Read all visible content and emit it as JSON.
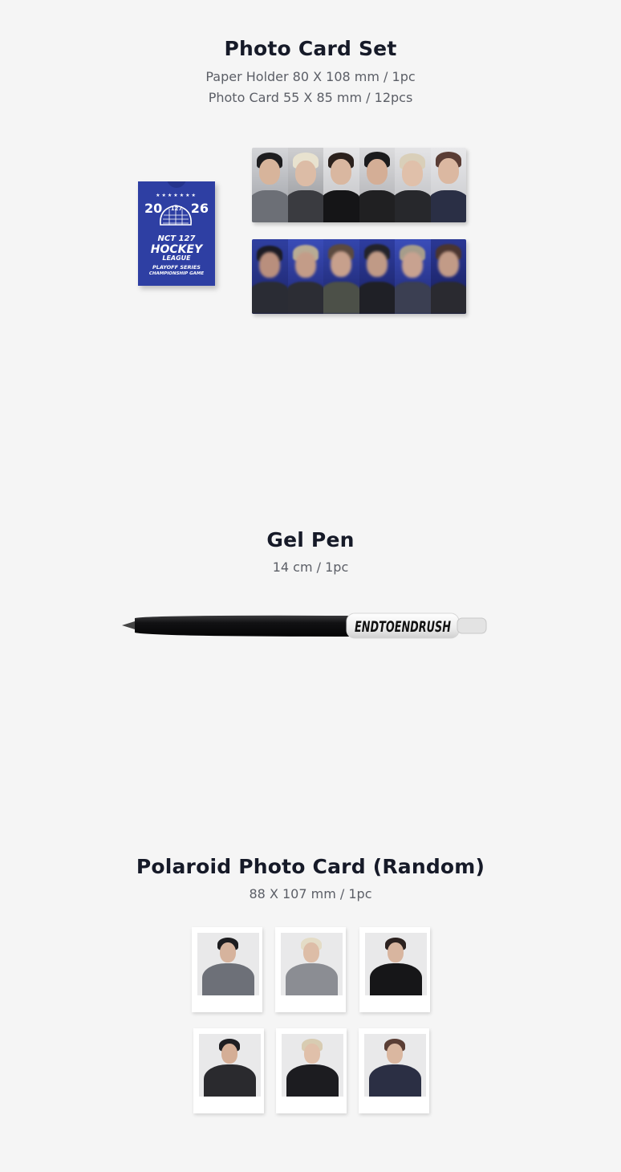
{
  "photo_card_set": {
    "title": "Photo Card Set",
    "spec_line_1": "Paper Holder 80 X 108 mm / 1pc",
    "spec_line_2": "Photo Card 55 X 85 mm / 12pcs",
    "holder": {
      "year_left": "20",
      "year_right": "26",
      "helmet_number": "127",
      "line_1": "NCT 127",
      "line_2": "HOCKEY",
      "line_3": "LEAGUE",
      "line_4": "PLAYOFF SERIES",
      "line_5": "CHAMPIONSHIP GAME",
      "color": "#2e3fa3"
    }
  },
  "gel_pen": {
    "title": "Gel Pen",
    "spec": "14 cm / 1pc",
    "clip_text": "ENDTOENDRUSH"
  },
  "polaroid": {
    "title": "Polaroid Photo Card (Random)",
    "spec": "88 X 107 mm / 1pc"
  }
}
